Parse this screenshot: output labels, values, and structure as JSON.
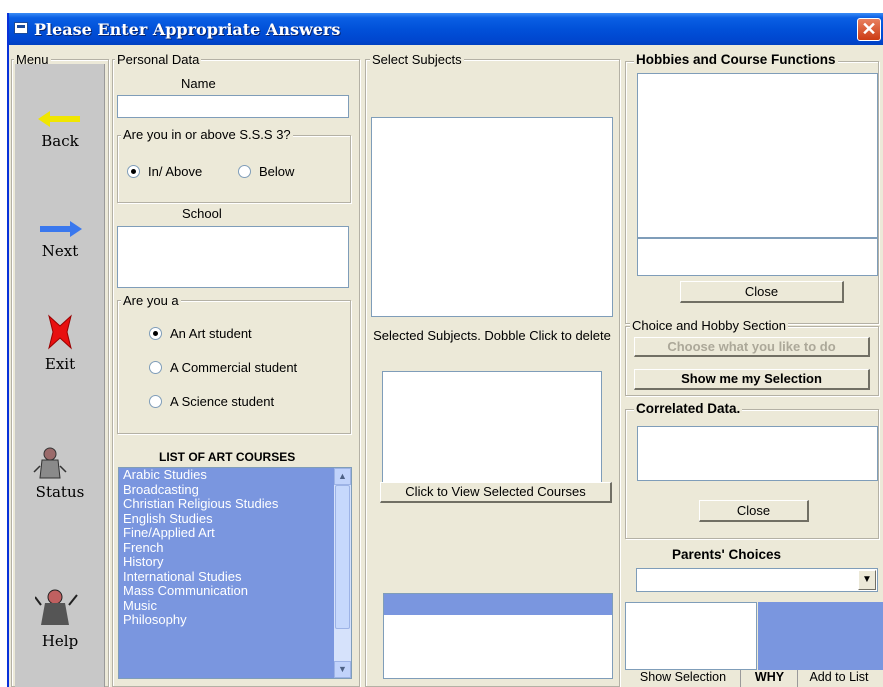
{
  "window": {
    "title": "Please Enter Appropriate Answers",
    "close_glyph": "✕"
  },
  "menu": {
    "legend": "Menu",
    "items": [
      {
        "label": "Back",
        "icon": "back-arrow-icon",
        "color": "#f0e600"
      },
      {
        "label": "Next",
        "icon": "next-arrow-icon",
        "color": "#3a78ee"
      },
      {
        "label": "Exit",
        "icon": "exit-x-icon",
        "color": "#e81010"
      },
      {
        "label": "Status",
        "icon": "status-figure-icon"
      },
      {
        "label": "Help",
        "icon": "help-figure-icon"
      }
    ]
  },
  "personal": {
    "legend": "Personal Data",
    "name_label": "Name",
    "name_value": "",
    "sss3_question": "Are you in or above S.S.S 3?",
    "sss3_options": [
      "In/ Above",
      "Below"
    ],
    "sss3_selected": "In/ Above",
    "school_label": "School",
    "school_value": "",
    "student_question": "Are you a",
    "student_options": [
      "An Art student",
      "A Commercial student",
      "A Science student"
    ],
    "student_selected": "An Art student",
    "courses_title": "LIST OF ART COURSES",
    "courses": [
      "Arabic Studies",
      "Broadcasting",
      "Christian Religious Studies",
      "English Studies",
      "Fine/Applied Art",
      "French",
      "History",
      "International Studies",
      "Mass Communication",
      "Music",
      "Philosophy"
    ]
  },
  "subjects": {
    "legend": "Select Subjects",
    "selected_caption": "Selected Subjects. Dobble Click to delete",
    "view_button": "Click to View Selected Courses"
  },
  "hobbies": {
    "legend": "Hobbies and Course Functions",
    "close_button": "Close",
    "choice_legend": "Choice and Hobby Section",
    "choose_button": "Choose what you like to do",
    "show_button": "Show me my Selection",
    "correlated_legend": "Correlated Data.",
    "close_button2": "Close",
    "parents_title": "Parents' Choices",
    "parents_value": "",
    "tabs": [
      "Show Selection",
      "WHY",
      "Add to List"
    ]
  },
  "colors": {
    "titlebar": "#0151d9",
    "list_highlight": "#7a96df",
    "face": "#ece9d8"
  }
}
